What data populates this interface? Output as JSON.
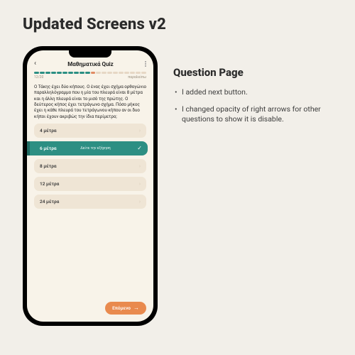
{
  "page_title": "Updated Screens v2",
  "side": {
    "heading": "Question Page",
    "bullets": [
      "I added next button.",
      "I changed opacity of right arrows for other questions to show it is disable."
    ]
  },
  "phone": {
    "title": "Μαθηματικά Quiz",
    "counter": "12/20",
    "skip_label": "παραλείπω",
    "progress_total": 20,
    "progress_done": 11,
    "progress_wrong_index": 10,
    "question": "Ο Τάκης έχει δύο κήπους. Ο ένας έχει σχήμα ορθογώνιο παραλληλόγραμμο που η μία του πλευρά είναι 8 μέτρα και η άλλη πλευρά είναι το μισό της πρώτης. Ο δεύτερος κήπος έχει τετράγωνο σχήμα. Πόσο μήκος έχει η κάθε πλευρά του τετράγωνου κήπου αν οι δυο κήποι έχουν ακριβώς την ίδια περίμετρο;",
    "answers": [
      {
        "label": "4 μέτρα"
      },
      {
        "label": "6 μέτρα",
        "selected": true,
        "hint": "Δείτε την εξήγηση"
      },
      {
        "label": "8 μέτρα"
      },
      {
        "label": "12 μέτρα"
      },
      {
        "label": "24 μέτρα"
      }
    ],
    "next_label": "Επόμενο"
  }
}
